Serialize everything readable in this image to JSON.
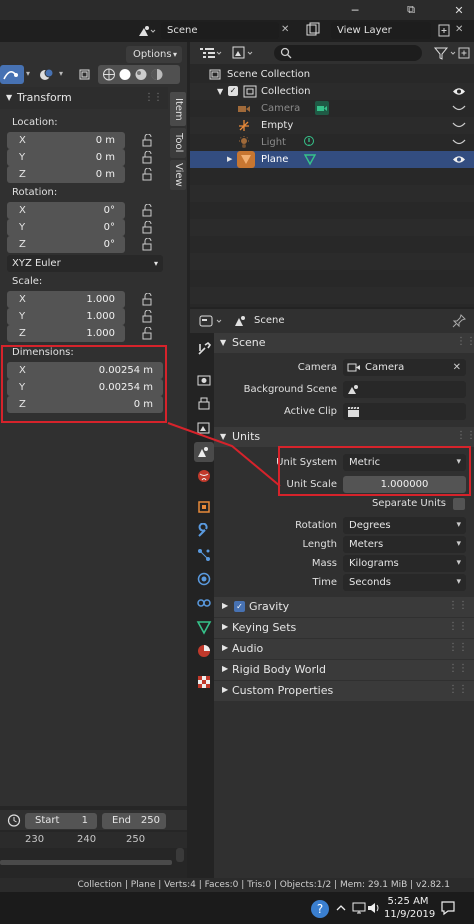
{
  "window": {
    "minimize": "─",
    "maximize": "⧉",
    "close": "✕"
  },
  "top_header": {
    "scene_name": "Scene",
    "view_layer": "View Layer"
  },
  "left_panel": {
    "options_label": "Options",
    "tabs": [
      "Item",
      "Tool",
      "View"
    ],
    "transform_title": "Transform",
    "location_label": "Location:",
    "location": [
      {
        "axis": "X",
        "value": "0 m"
      },
      {
        "axis": "Y",
        "value": "0 m"
      },
      {
        "axis": "Z",
        "value": "0 m"
      }
    ],
    "rotation_label": "Rotation:",
    "rotation": [
      {
        "axis": "X",
        "value": "0°"
      },
      {
        "axis": "Y",
        "value": "0°"
      },
      {
        "axis": "Z",
        "value": "0°"
      }
    ],
    "rotation_mode": "XYZ Euler",
    "scale_label": "Scale:",
    "scale": [
      {
        "axis": "X",
        "value": "1.000"
      },
      {
        "axis": "Y",
        "value": "1.000"
      },
      {
        "axis": "Z",
        "value": "1.000"
      }
    ],
    "dimensions_label": "Dimensions:",
    "dimensions": [
      {
        "axis": "X",
        "value": "0.00254 m"
      },
      {
        "axis": "Y",
        "value": "0.00254 m"
      },
      {
        "axis": "Z",
        "value": "0 m"
      }
    ]
  },
  "timeline": {
    "start_label": "Start",
    "start_value": "1",
    "end_label": "End",
    "end_value": "250",
    "ticks": [
      "230",
      "240",
      "250"
    ]
  },
  "outliner": {
    "scene_collection": "Scene Collection",
    "collection": "Collection",
    "items": [
      {
        "name": "Camera",
        "dimmed": true
      },
      {
        "name": "Empty",
        "dimmed": false
      },
      {
        "name": "Light",
        "dimmed": true
      },
      {
        "name": "Plane",
        "dimmed": false,
        "selected": true
      }
    ]
  },
  "properties": {
    "context_name": "Scene",
    "scene_panel": {
      "title": "Scene",
      "camera_label": "Camera",
      "camera_value": "Camera",
      "background_label": "Background Scene",
      "active_clip_label": "Active Clip"
    },
    "units_panel": {
      "title": "Units",
      "unit_system_label": "Unit System",
      "unit_system_value": "Metric",
      "unit_scale_label": "Unit Scale",
      "unit_scale_value": "1.000000",
      "separate_units_label": "Separate Units",
      "rotation_label": "Rotation",
      "rotation_value": "Degrees",
      "length_label": "Length",
      "length_value": "Meters",
      "mass_label": "Mass",
      "mass_value": "Kilograms",
      "time_label": "Time",
      "time_value": "Seconds"
    },
    "collapsed_panels": [
      "Gravity",
      "Keying Sets",
      "Audio",
      "Rigid Body World",
      "Custom Properties"
    ]
  },
  "status_bar": {
    "text": "Collection | Plane | Verts:4 | Faces:0 | Tris:0 | Objects:1/2 | Mem: 29.1 MiB | v2.82.1"
  },
  "taskbar": {
    "time": "5:25 AM",
    "date": "11/9/2019"
  },
  "colors": {
    "selection": "#334d80",
    "annotation_red": "#d6232b",
    "orange_object": "#e88a3a",
    "green_data": "#36c28a"
  }
}
